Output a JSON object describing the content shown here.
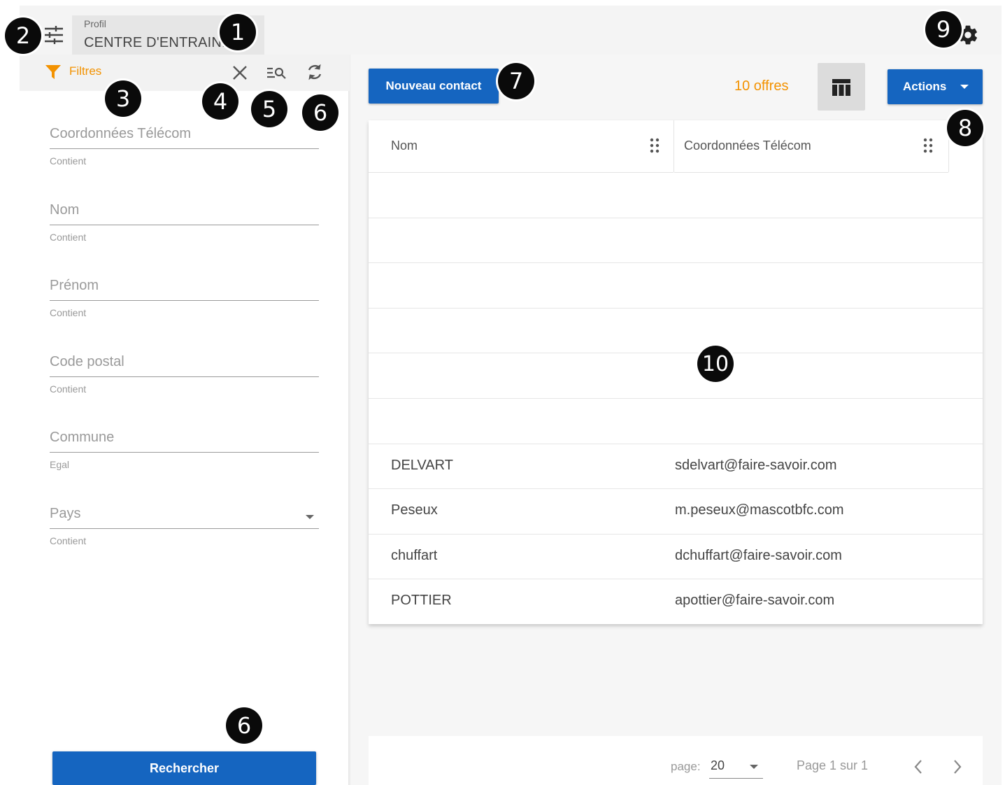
{
  "header": {
    "profile_label": "Profil",
    "profile_value": "CENTRE D'ENTRAIN..."
  },
  "filters": {
    "title": "Filtres",
    "fields": [
      {
        "label": "Coordonnées Télécom",
        "operator": "Contient"
      },
      {
        "label": "Nom",
        "operator": "Contient"
      },
      {
        "label": "Prénom",
        "operator": "Contient"
      },
      {
        "label": "Code postal",
        "operator": "Contient"
      },
      {
        "label": "Commune",
        "operator": "Egal"
      },
      {
        "label": "Pays",
        "operator": "Contient"
      }
    ],
    "search_button": "Rechercher"
  },
  "toolbar": {
    "new_contact": "Nouveau contact",
    "offers_count": "10 offres",
    "actions": "Actions"
  },
  "table": {
    "columns": [
      "Nom",
      "Coordonnées Télécom"
    ],
    "rows": [
      {
        "nom": "",
        "telecom": ""
      },
      {
        "nom": "",
        "telecom": ""
      },
      {
        "nom": "",
        "telecom": ""
      },
      {
        "nom": "",
        "telecom": ""
      },
      {
        "nom": "",
        "telecom": ""
      },
      {
        "nom": "",
        "telecom": ""
      },
      {
        "nom": "DELVART",
        "telecom": "sdelvart@faire-savoir.com"
      },
      {
        "nom": "Peseux",
        "telecom": "m.peseux@mascotbfc.com"
      },
      {
        "nom": "chuffart",
        "telecom": "dchuffart@faire-savoir.com"
      },
      {
        "nom": "POTTIER",
        "telecom": "apottier@faire-savoir.com"
      }
    ]
  },
  "pagination": {
    "page_size_label": "page:",
    "page_size": "20",
    "page_info": "Page 1 sur 1"
  },
  "annotations": [
    "1",
    "2",
    "3",
    "4",
    "5",
    "6",
    "6",
    "7",
    "8",
    "9",
    "10"
  ],
  "colors": {
    "primary": "#1565c0",
    "accent": "#f39200"
  },
  "icons": [
    "sliders-icon",
    "settings-gear-icon",
    "filter-funnel-icon",
    "clear-x-icon",
    "search-list-icon",
    "refresh-icon",
    "table-view-icon",
    "caret-down-icon",
    "drag-handle-icon",
    "chevron-left-icon",
    "chevron-right-icon"
  ]
}
